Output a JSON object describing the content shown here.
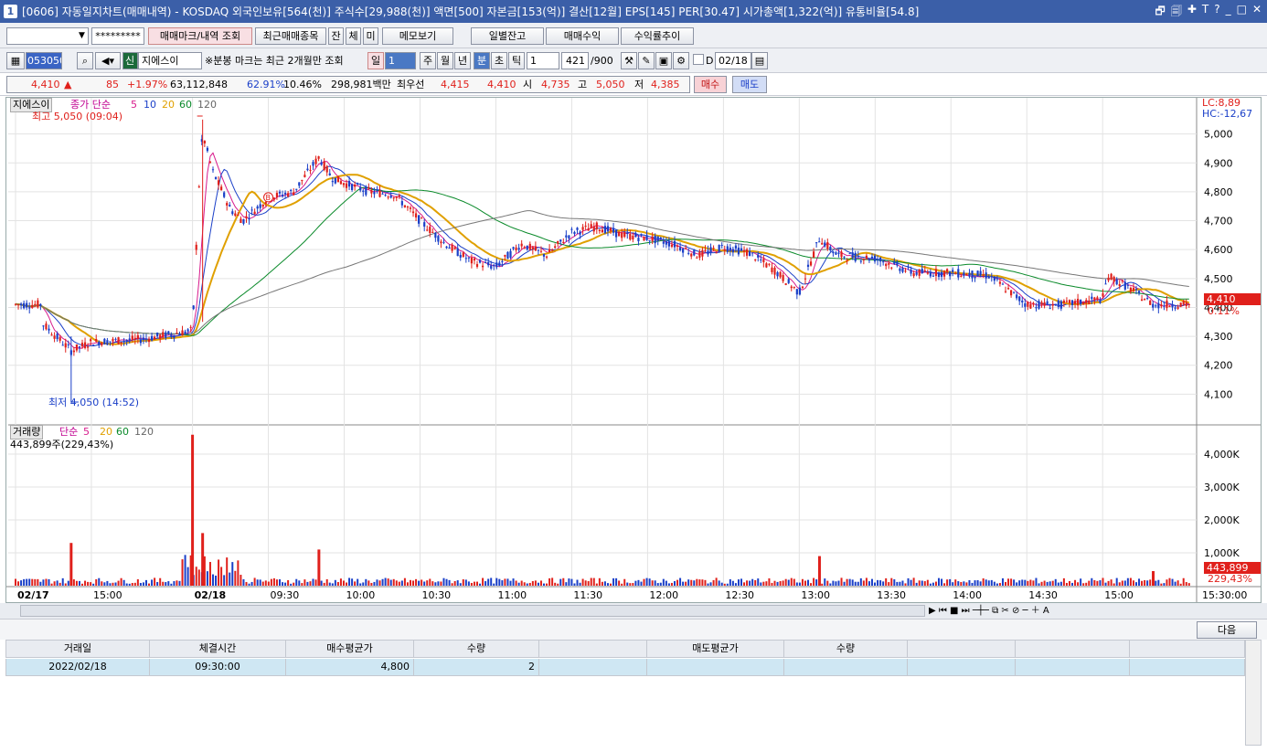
{
  "window": {
    "num": "1",
    "title": "[0606] 자동일지차트(매매내역) - KOSDAQ 외국인보유[564(천)] 주식수[29,988(천)] 액면[500] 자본금[153(억)] 결산[12월] EPS[145] PER[30.47] 시가총액[1,322(억)] 유통비율[54.8]",
    "ctrls": [
      "🗗",
      "🗐",
      "✚",
      "T",
      "?",
      "_",
      "□",
      "✕"
    ]
  },
  "toolbar1": {
    "account_field": "",
    "password_field": "*********",
    "btn_mark": "매매마크/내역 조회",
    "btn_recent": "최근매매종목",
    "btn_jan": "잔",
    "btn_che": "체",
    "btn_mi": "미",
    "btn_memo": "메모보기",
    "btn_daily": "일별잔고",
    "btn_profit": "매매수익",
    "btn_return": "수익률추이"
  },
  "toolbar2": {
    "code": "053050",
    "sin": "신",
    "stock_name": "지에스이",
    "notice": "※분봉 마크는 최근 2개월만 조회",
    "btn_day": "일",
    "period_sel": "1",
    "btn_week": "주",
    "btn_month": "월",
    "btn_year": "년",
    "btn_min": "분",
    "btn_sec": "초",
    "btn_tick": "틱",
    "unit_sel": "1",
    "count": "421",
    "count_total": "/900",
    "date_label": "D",
    "date": "02/18"
  },
  "quote": {
    "price": "4,410",
    "arrow": "▲",
    "change": "85",
    "pct": "+1.97%",
    "volume": "63,112,848",
    "ratio1": "62.91%",
    "ratio2": "10.46%",
    "amount": "298,981백만",
    "best_label": "최우선",
    "best_ask": "4,415",
    "best_bid": "4,410",
    "open_label": "시",
    "open": "4,735",
    "high_label": "고",
    "high": "5,050",
    "low_label": "저",
    "low": "4,385",
    "buy_btn": "매수",
    "sell_btn": "매도"
  },
  "price_panel": {
    "name_tag": "지에스이",
    "legend_prefix": "종가 단순",
    "ma_labels": [
      "5",
      "10",
      "20",
      "60",
      "120"
    ],
    "lc": "LC:8,89",
    "hc": "HC:-12,67",
    "high_note": "최고 5,050 (09:04)",
    "low_note": "최저 4,050 (14:52)",
    "cur_price": "4,410",
    "cur_pct": "0.11%"
  },
  "volume_panel": {
    "legend_prefix": "거래량",
    "legend_mid": "단순",
    "ma_labels": [
      "5",
      "20",
      "60",
      "120"
    ],
    "vol_info": "443,899주(229,43%)",
    "cur_vol": "443,899",
    "cur_pct": "229,43%"
  },
  "chart_data": [
    {
      "type": "candlestick",
      "title": "",
      "y_ticks": [
        "5,000",
        "4,900",
        "4,800",
        "4,700",
        "4,600",
        "4,500",
        "4,400",
        "4,300",
        "4,200",
        "4,100"
      ],
      "ylim": [
        4000,
        5100
      ],
      "colors": {
        "up": "#e0201b",
        "down": "#1a3fc8",
        "ma5": "#d81b8c",
        "ma10": "#1a3fc8",
        "ma20": "#e0a000",
        "ma60": "#0a8a2a",
        "ma120": "#777777"
      },
      "x_ticks": [
        "02/17",
        "15:00",
        "02/18",
        "09:30",
        "10:00",
        "10:30",
        "11:00",
        "11:30",
        "12:00",
        "12:30",
        "13:00",
        "13:30",
        "14:00",
        "14:30",
        "15:00",
        "15:30:00"
      ],
      "close_path": [
        [
          "02/17 14:40",
          4350
        ],
        [
          "02/17 14:52",
          4250
        ],
        [
          "02/17 15:00",
          4280
        ],
        [
          "02/17 15:20",
          4290
        ],
        [
          "09:00",
          4320
        ],
        [
          "09:03",
          4900
        ],
        [
          "09:04",
          5000
        ],
        [
          "09:08",
          4870
        ],
        [
          "09:15",
          4740
        ],
        [
          "09:20",
          4700
        ],
        [
          "09:30",
          4780
        ],
        [
          "09:40",
          4800
        ],
        [
          "09:50",
          4920
        ],
        [
          "09:55",
          4850
        ],
        [
          "10:00",
          4830
        ],
        [
          "10:10",
          4800
        ],
        [
          "10:20",
          4790
        ],
        [
          "10:30",
          4700
        ],
        [
          "10:40",
          4620
        ],
        [
          "10:50",
          4560
        ],
        [
          "11:00",
          4540
        ],
        [
          "11:10",
          4620
        ],
        [
          "11:20",
          4580
        ],
        [
          "11:30",
          4660
        ],
        [
          "11:40",
          4680
        ],
        [
          "11:50",
          4650
        ],
        [
          "12:00",
          4640
        ],
        [
          "12:10",
          4620
        ],
        [
          "12:20",
          4580
        ],
        [
          "12:30",
          4610
        ],
        [
          "12:40",
          4590
        ],
        [
          "12:50",
          4530
        ],
        [
          "13:00",
          4450
        ],
        [
          "13:08",
          4640
        ],
        [
          "13:15",
          4580
        ],
        [
          "13:30",
          4570
        ],
        [
          "13:45",
          4520
        ],
        [
          "14:00",
          4520
        ],
        [
          "14:15",
          4510
        ],
        [
          "14:30",
          4410
        ],
        [
          "14:45",
          4410
        ],
        [
          "15:00",
          4430
        ],
        [
          "15:02",
          4510
        ],
        [
          "15:10",
          4470
        ],
        [
          "15:20",
          4410
        ]
      ]
    },
    {
      "type": "bar",
      "title": "",
      "y_ticks": [
        "4,000K",
        "3,000K",
        "2,000K",
        "1,000K"
      ],
      "ylim": [
        0,
        4500000
      ],
      "colors": {
        "up": "#e0201b",
        "down": "#1a3fc8"
      },
      "highlights": [
        {
          "time": "02/17 14:52",
          "value": 1300000
        },
        {
          "time": "09:00",
          "value": 4800000
        },
        {
          "time": "09:04",
          "value": 1600000
        },
        {
          "time": "09:50",
          "value": 1100000
        },
        {
          "time": "13:08",
          "value": 900000
        },
        {
          "time": "15:20",
          "value": 443899
        }
      ]
    }
  ],
  "bottom": {
    "next_btn": "다음",
    "headers": [
      "거래일",
      "체결시간",
      "매수평균가",
      "수량",
      "",
      "매도평균가",
      "수량",
      "",
      "",
      ""
    ],
    "rows": [
      {
        "date": "2022/02/18",
        "time": "09:30:00",
        "buy_avg": "4,800",
        "qty": "2"
      }
    ]
  }
}
